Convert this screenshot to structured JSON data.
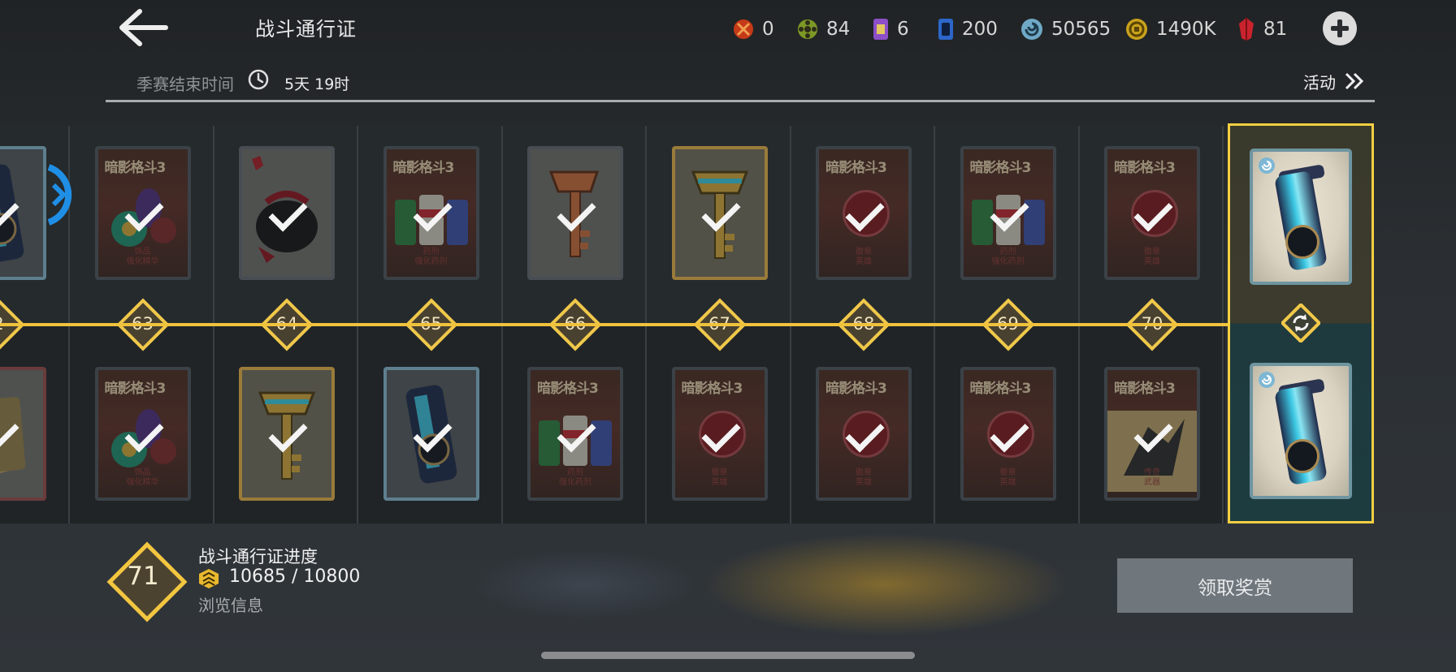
{
  "header": {
    "title": "战斗通行证",
    "currencies": [
      {
        "icon": "red-token-icon",
        "value": "0",
        "color": "#d8461c"
      },
      {
        "icon": "green-gear-icon",
        "value": "84",
        "color": "#9bb33a"
      },
      {
        "icon": "purple-ticket-icon",
        "value": "6",
        "color": "#9b5fd3"
      },
      {
        "icon": "blue-card-icon",
        "value": "200",
        "color": "#3a7bd8"
      },
      {
        "icon": "swirl-orb-icon",
        "value": "50565",
        "color": "#7fb9d8"
      },
      {
        "icon": "gold-coin-icon",
        "value": "1490K",
        "color": "#d7b42a"
      },
      {
        "icon": "red-gem-icon",
        "value": "81",
        "color": "#d9333b"
      }
    ]
  },
  "season": {
    "label": "季赛结束时间",
    "time": "5天 19时",
    "activity": "活动"
  },
  "track": {
    "levels": [
      "2",
      "63",
      "64",
      "65",
      "66",
      "67",
      "68",
      "69",
      "70"
    ],
    "top_rewards": [
      {
        "kind": "tube",
        "claimed": true
      },
      {
        "kind": "potions",
        "claimed": true,
        "logo": "暗影格斗3",
        "caption": "饰品\n强化精华"
      },
      {
        "kind": "bag",
        "claimed": true
      },
      {
        "kind": "jars",
        "claimed": true,
        "logo": "暗影格斗3",
        "caption": "药剂\n强化药剂"
      },
      {
        "kind": "copper-key",
        "claimed": true
      },
      {
        "kind": "gold-key",
        "claimed": true
      },
      {
        "kind": "emblem",
        "claimed": true,
        "logo": "暗影格斗3",
        "caption": "徽章\n英雄"
      },
      {
        "kind": "jars",
        "claimed": true,
        "logo": "暗影格斗3",
        "caption": "药剂\n强化药剂"
      },
      {
        "kind": "emblem",
        "claimed": true,
        "logo": "暗影格斗3",
        "caption": "徽章\n英雄"
      }
    ],
    "bottom_rewards": [
      {
        "kind": "cards",
        "claimed": true
      },
      {
        "kind": "potions",
        "claimed": true,
        "logo": "暗影格斗3",
        "caption": "饰品\n强化精华"
      },
      {
        "kind": "gold-key",
        "claimed": true
      },
      {
        "kind": "tube",
        "claimed": true
      },
      {
        "kind": "jars",
        "claimed": true,
        "logo": "暗影格斗3",
        "caption": "药剂\n强化药剂"
      },
      {
        "kind": "emblem",
        "claimed": true,
        "logo": "暗影格斗3",
        "caption": "徽章\n英雄"
      },
      {
        "kind": "emblem",
        "claimed": true,
        "logo": "暗影格斗3",
        "caption": "徽章\n英雄"
      },
      {
        "kind": "emblem",
        "claimed": true,
        "logo": "暗影格斗3",
        "caption": "徽章\n英雄"
      },
      {
        "kind": "fighter",
        "claimed": true,
        "logo": "暗影格斗3",
        "caption": "传奇\n武器"
      }
    ],
    "highlight": {
      "top": "swirl-tube",
      "bottom": "swirl-tube",
      "icon": "refresh-icon"
    }
  },
  "progress": {
    "level": "71",
    "title": "战斗通行证进度",
    "value": "10685 / 10800",
    "browse": "浏览信息"
  },
  "claim_button": "领取奖赏"
}
